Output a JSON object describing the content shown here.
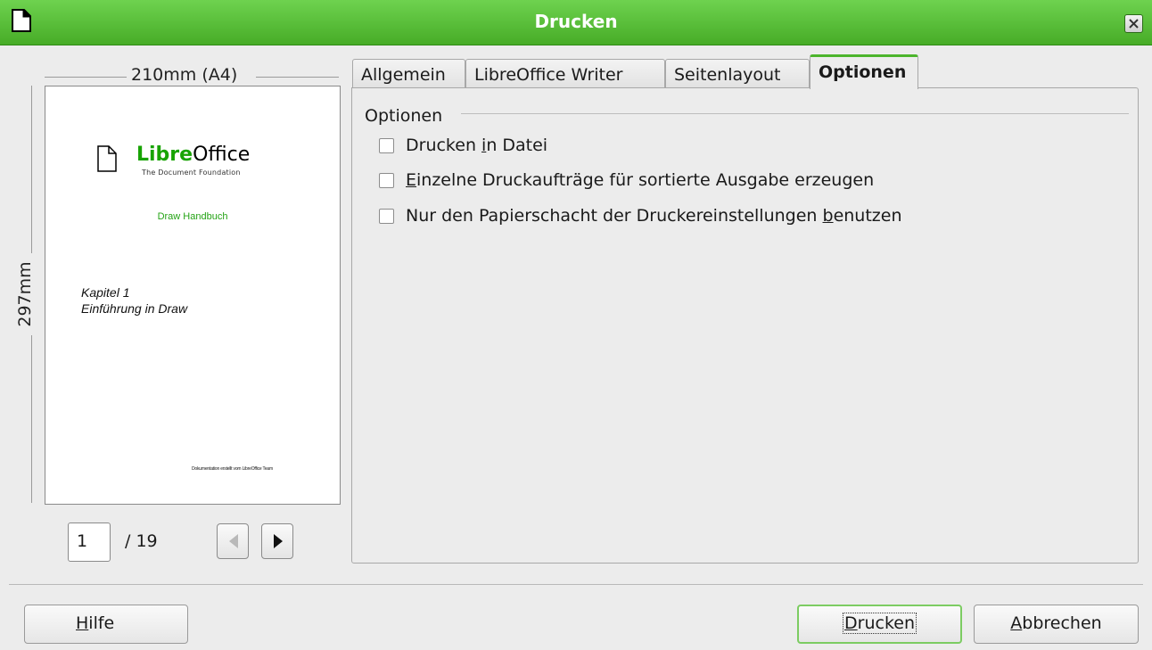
{
  "window": {
    "title": "Drucken",
    "icon": "document-icon",
    "accent": "#47ac27"
  },
  "preview": {
    "width_label": "210mm (A4)",
    "height_label": "297mm",
    "page_content": {
      "brand_libre": "Libre",
      "brand_office": "Office",
      "brand_tagline": "The Document Foundation",
      "subtitle": "Draw Handbuch",
      "chapter_line1": "Kapitel 1",
      "chapter_line2": "Einführung in Draw",
      "footer": "Dokumentation erstellt vom LibreOffice Team"
    },
    "page_number": "1",
    "page_total": "/ 19"
  },
  "tabs": [
    {
      "label": "Allgemein",
      "active": false
    },
    {
      "label": "LibreOffice Writer",
      "active": false
    },
    {
      "label": "Seitenlayout",
      "active": false
    },
    {
      "label": "Optionen",
      "active": true
    }
  ],
  "options_panel": {
    "group_label": "Optionen",
    "options": [
      {
        "pre": "Drucken ",
        "mnemonic": "i",
        "post": "n Datei",
        "checked": false
      },
      {
        "pre": "",
        "mnemonic": "E",
        "post": "inzelne Druckaufträge für sortierte Ausgabe erzeugen",
        "checked": false
      },
      {
        "pre": "Nur den Papierschacht der Druckereinstellungen ",
        "mnemonic": "b",
        "post": "enutzen",
        "checked": false
      }
    ]
  },
  "buttons": {
    "help": {
      "mnemonic": "H",
      "rest": "ilfe"
    },
    "print": {
      "mnemonic": "D",
      "rest": "rucken"
    },
    "cancel": {
      "mnemonic": "A",
      "rest": "bbrechen"
    }
  }
}
